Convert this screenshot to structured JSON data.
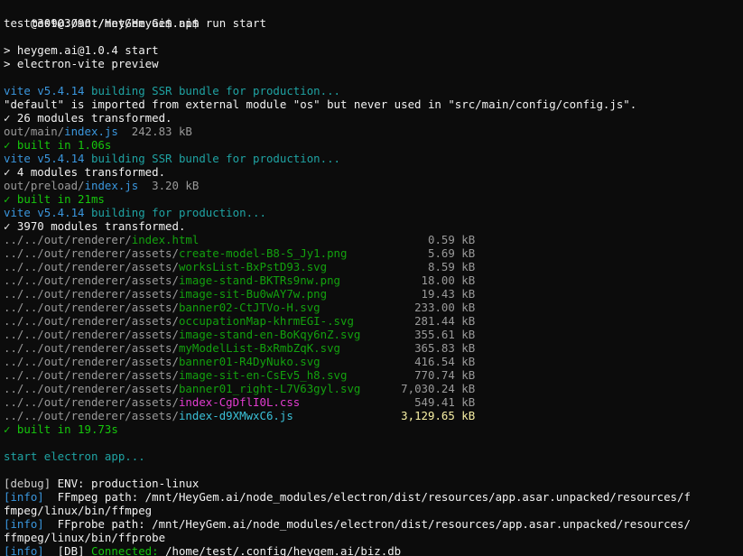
{
  "colors": {
    "background": "#0c0c0c",
    "text": "#cccccc",
    "vite_label": "#3a96dd",
    "building_text": "#1fa3a3",
    "check_green": "#16c60c",
    "file_green": "#13a10e",
    "css_magenta": "#e33cd0",
    "js_yellow": "#f9f1a5",
    "info_blue": "#3a96dd"
  },
  "prompt": {
    "line1": "test@3090:/mnt/HeyGem.ai$",
    "line2_prompt": "test@3090:/mnt/HeyGem.ai$",
    "line2_cmd": " npm run start"
  },
  "npm": {
    "script_line": "> heygem.ai@1.0.4 start",
    "cmd_line": "> electron-vite preview"
  },
  "main_build": {
    "vite": "vite v5.4.14",
    "building": " building SSR bundle for production...",
    "warning": "\"default\" is imported from external module \"os\" but never used in \"src/main/config/config.js\".",
    "transformed": "✓ 26 modules transformed.",
    "out_dir": "out/main/",
    "out_file": "index.js",
    "out_size": "  242.83 kB",
    "built": "✓ built in 1.06s"
  },
  "preload_build": {
    "vite": "vite v5.4.14",
    "building": " building SSR bundle for production...",
    "transformed": "✓ 4 modules transformed.",
    "out_dir": "out/preload/",
    "out_file": "index.js",
    "out_size": "  3.20 kB",
    "built": "✓ built in 21ms"
  },
  "renderer_build": {
    "vite": "vite v5.4.14",
    "building": " building for production...",
    "transformed": "✓ 3970 modules transformed.",
    "files": [
      {
        "dir": "../../out/renderer/",
        "name": "index.html",
        "size": "0.59 kB",
        "kind": "html"
      },
      {
        "dir": "../../out/renderer/assets/",
        "name": "create-model-B8-S_Jy1.png",
        "size": "5.69 kB",
        "kind": "asset"
      },
      {
        "dir": "../../out/renderer/assets/",
        "name": "worksList-BxPstD93.svg",
        "size": "8.59 kB",
        "kind": "asset"
      },
      {
        "dir": "../../out/renderer/assets/",
        "name": "image-stand-BKTRs9nw.png",
        "size": "18.00 kB",
        "kind": "asset"
      },
      {
        "dir": "../../out/renderer/assets/",
        "name": "image-sit-Bu0wAY7w.png",
        "size": "19.43 kB",
        "kind": "asset"
      },
      {
        "dir": "../../out/renderer/assets/",
        "name": "banner02-CtJTVo-H.svg",
        "size": "233.00 kB",
        "kind": "asset"
      },
      {
        "dir": "../../out/renderer/assets/",
        "name": "occupationMap-khrmEGI-.svg",
        "size": "281.44 kB",
        "kind": "asset"
      },
      {
        "dir": "../../out/renderer/assets/",
        "name": "image-stand-en-BoKqy6nZ.svg",
        "size": "355.61 kB",
        "kind": "asset"
      },
      {
        "dir": "../../out/renderer/assets/",
        "name": "myModelList-BxRmbZqK.svg",
        "size": "365.83 kB",
        "kind": "asset"
      },
      {
        "dir": "../../out/renderer/assets/",
        "name": "banner01-R4DyNuko.svg",
        "size": "416.54 kB",
        "kind": "asset"
      },
      {
        "dir": "../../out/renderer/assets/",
        "name": "image-sit-en-CsEv5_h8.svg",
        "size": "770.74 kB",
        "kind": "asset"
      },
      {
        "dir": "../../out/renderer/assets/",
        "name": "banner01_right-L7V63gyl.svg",
        "size": "7,030.24 kB",
        "kind": "asset"
      },
      {
        "dir": "../../out/renderer/assets/",
        "name": "index-CgDflI0L.css",
        "size": "549.41 kB",
        "kind": "css"
      },
      {
        "dir": "../../out/renderer/assets/",
        "name": "index-d9XMwxC6.js",
        "size": "3,129.65 kB",
        "kind": "js"
      }
    ],
    "built": "✓ built in 19.73s"
  },
  "electron": {
    "start": "start electron app..."
  },
  "logs": {
    "debug_tag": "[debug]",
    "debug_msg": " ENV: production-linux",
    "info1_tag": "[info]",
    "info1_msg": "  FFmpeg path: /mnt/HeyGem.ai/node_modules/electron/dist/resources/app.asar.unpacked/resources/f",
    "info1_cont": "fmpeg/linux/bin/ffmpeg",
    "info2_tag": "[info]",
    "info2_msg": "  FFprobe path: /mnt/HeyGem.ai/node_modules/electron/dist/resources/app.asar.unpacked/resources/",
    "info2_cont": "ffmpeg/linux/bin/ffprobe",
    "info3_tag": "[info]",
    "info3_db": "  [DB] ",
    "info3_connected": "Connected:",
    "info3_path": " /home/test/.config/heygem.ai/biz.db"
  }
}
